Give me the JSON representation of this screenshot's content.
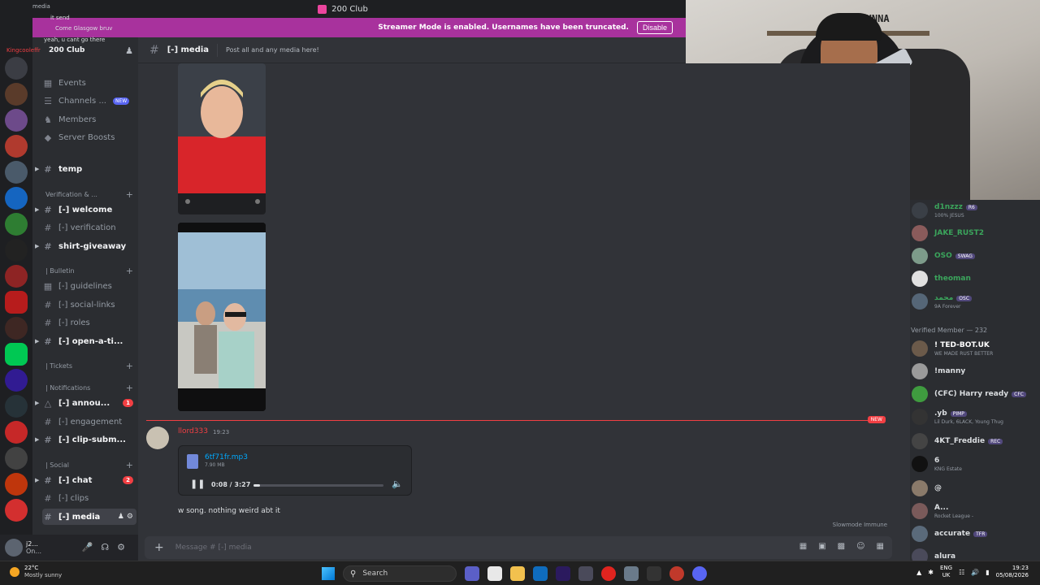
{
  "titlebar": {
    "title": "200 Club"
  },
  "banner": {
    "text": "Streamer Mode is enabled. Usernames have been truncated.",
    "disable_label": "Disable"
  },
  "overlay": {
    "lines": [
      {
        "name": "",
        "text": "media"
      },
      {
        "name": "",
        "text": "it send"
      },
      {
        "name": "",
        "text": "Come Glasgow bruv"
      },
      {
        "name": "",
        "text": "yeah, u cant go there"
      },
      {
        "name": "Kingcooleffr",
        "text": ""
      }
    ]
  },
  "sidebar": {
    "server_name": "200 Club",
    "events": "Events",
    "channels": "Channels ...",
    "channels_new": "NEW",
    "members": "Members",
    "boosts": "Server Boosts",
    "temp": "temp",
    "cat_verification": "Verification & ...",
    "welcome": "[-] welcome",
    "verification": "[-] verification",
    "shirt": "shirt-giveaway",
    "cat_bulletin": "| Bulletin",
    "guidelines": "[-] guidelines",
    "social_links": "[-] social-links",
    "roles": "[-] roles",
    "open_ticket": "[-] open-a-ti...",
    "cat_tickets": "| Tickets",
    "cat_notifications": "| Notifications",
    "announcements": "[-] annou...",
    "announcements_badge": "1",
    "engagement": "[-] engagement",
    "clip_sub": "[-] clip-subm...",
    "cat_social": "| Social",
    "chat": "[-] chat",
    "chat_badge": "2",
    "clips": "[-] clips",
    "media": "[-] media"
  },
  "user_panel": {
    "name": "j2...",
    "status": "On..."
  },
  "chat": {
    "channel": "[-] media",
    "topic": "Post all and any media here!",
    "new_label": "NEW",
    "author": "llord333",
    "time": "19:23",
    "file_name": "6tf71fr.mp3",
    "file_size": "7.90 MB",
    "play_time": "0:08 / 3:27",
    "progress": 0.05,
    "message": "w song. nothing weird abt it",
    "slowmode": "Slowmode Immune",
    "composer_placeholder": "Message # [-] media"
  },
  "members": {
    "verified_header": "Verified Member — 232",
    "top": [
      {
        "name": "d1nzzz",
        "tag": "R6",
        "sub": "100% JESUS"
      },
      {
        "name": "JAKE_RUST2",
        "tag": "",
        "sub": ""
      },
      {
        "name": "OSO",
        "tag": "SWAG",
        "sub": ""
      },
      {
        "name": "theoman",
        "tag": "",
        "sub": ""
      },
      {
        "name": "محمد",
        "tag": "OSC",
        "sub": "9A Forever"
      }
    ],
    "verified": [
      {
        "name": "! TED-BOT.UK",
        "tag": "",
        "sub": "WE MADE RUST BETTER"
      },
      {
        "name": "!manny",
        "tag": "",
        "sub": ""
      },
      {
        "name": "(CFC) Harry ready",
        "tag": "CFC",
        "sub": ""
      },
      {
        "name": ".yb",
        "tag": "PIMP",
        "sub": "Lil Durk, 6LACK, Young Thug"
      },
      {
        "name": "4KT_Freddie",
        "tag": "REC",
        "sub": ""
      },
      {
        "name": "6",
        "tag": "",
        "sub": "KNG Estate"
      },
      {
        "name": "@",
        "tag": "",
        "sub": ""
      },
      {
        "name": "A...",
        "tag": "",
        "sub": "Rocket League -"
      },
      {
        "name": "accurate",
        "tag": "TFR",
        "sub": ""
      },
      {
        "name": "alura",
        "tag": "",
        "sub": ""
      }
    ]
  },
  "webcam": {
    "wall_text": "J2HUNNA"
  },
  "taskbar": {
    "temp": "22°C",
    "weather": "Mostly sunny",
    "search": "Search",
    "lang1": "ENG",
    "lang2": "UK",
    "time": "19:23",
    "date": "05/08/2026"
  }
}
